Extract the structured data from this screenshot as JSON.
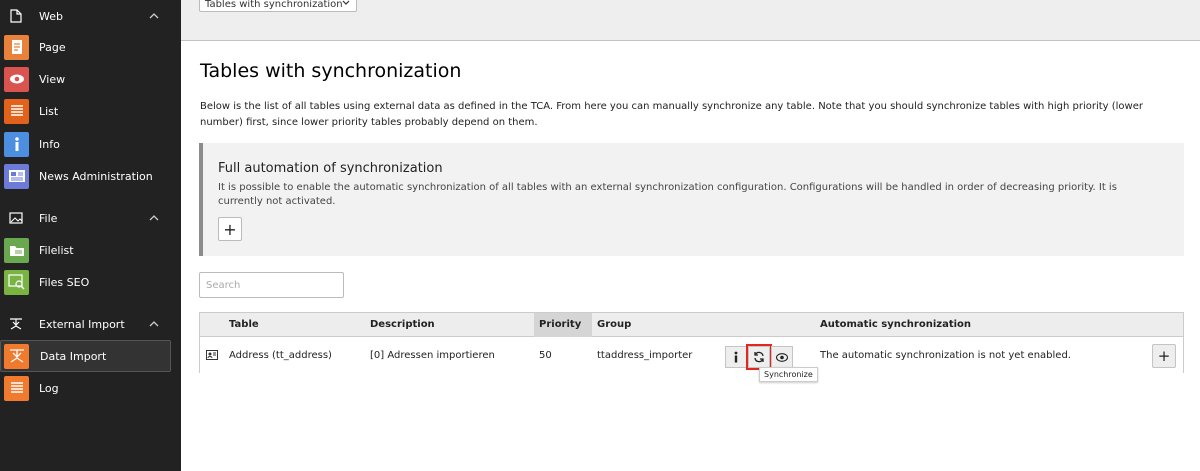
{
  "sidebar": {
    "groups": [
      {
        "label": "Web",
        "icon": "document-icon"
      },
      {
        "label": "File",
        "icon": "image-icon"
      },
      {
        "label": "External Import",
        "icon": "import-icon"
      }
    ],
    "modules": [
      {
        "label": "Page",
        "color": "#e8813a",
        "icon": "page-icon"
      },
      {
        "label": "View",
        "color": "#d9534f",
        "icon": "eye-icon"
      },
      {
        "label": "List",
        "color": "#e2621c",
        "icon": "list-icon"
      },
      {
        "label": "Info",
        "color": "#4c8ee0",
        "icon": "info-icon"
      },
      {
        "label": "News Administration",
        "color": "#6c7ad8",
        "icon": "news-icon"
      },
      {
        "label": "Filelist",
        "color": "#6aa84f",
        "icon": "filelist-icon"
      },
      {
        "label": "Files SEO",
        "color": "#79b443",
        "icon": "files-seo-icon"
      },
      {
        "label": "Data Import",
        "color": "#f07a2e",
        "icon": "data-import-icon"
      },
      {
        "label": "Log",
        "color": "#f07a2e",
        "icon": "log-icon"
      }
    ]
  },
  "topbar": {
    "view_selector": "Tables with synchronization"
  },
  "main": {
    "title": "Tables with synchronization",
    "intro": "Below is the list of all tables using external data as defined in the TCA. From here you can manually synchronize any table. Note that you should synchronize tables with high priority (lower number) first, since lower priority tables probably depend on them.",
    "callout": {
      "title": "Full automation of synchronization",
      "text": "It is possible to enable the automatic synchronization of all tables with an external synchronization configuration. Configurations will be handled in order of decreasing priority. It is currently not activated.",
      "add_label": "+"
    },
    "search": {
      "placeholder": "Search"
    },
    "table": {
      "headers": {
        "table": "Table",
        "description": "Description",
        "priority": "Priority",
        "group": "Group",
        "auto_sync": "Automatic synchronization"
      },
      "rows": [
        {
          "table": "Address (tt_address)",
          "description": "[0] Adressen importieren",
          "priority": "50",
          "group": "ttaddress_importer",
          "auto_sync": "The automatic synchronization is not yet enabled.",
          "add_label": "+"
        }
      ]
    },
    "tooltip": "Synchronize"
  },
  "colors": {
    "sidebar_bg": "#222222",
    "highlight": "#e3271f"
  }
}
